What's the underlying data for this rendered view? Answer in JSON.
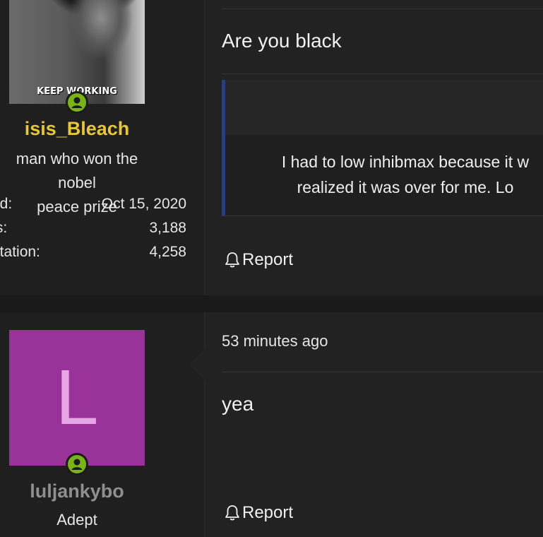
{
  "posts": [
    {
      "user": {
        "avatar_caption": "KEEP WORKING",
        "online_icon": "user-online-icon",
        "username": "isis_Bleach",
        "username_color": "#e8c53a",
        "title_lines": [
          "man who won the nobel",
          "peace prize"
        ],
        "stats": [
          {
            "label": "ed:",
            "value": "Oct 15, 2020"
          },
          {
            "label": "ts:",
            "value": "3,188"
          },
          {
            "label": "utation:",
            "value": "4,258"
          }
        ]
      },
      "text": "Are you black",
      "quote": {
        "lines": [
          "I had to low inhibmax because it w",
          "realized it was over for me. Lo"
        ],
        "border_color": "#2c3e7a"
      },
      "report_label": "Report"
    },
    {
      "user": {
        "avatar_letter": "L",
        "avatar_bg": "#993399",
        "avatar_letter_color": "#e5a6e5",
        "online_icon": "user-online-icon",
        "username": "luljankybo",
        "username_color": "#8f8f8f",
        "title": "Adept"
      },
      "timestamp": "53 minutes ago",
      "text": "yea",
      "report_label": "Report"
    }
  ],
  "colors": {
    "online_green": "#7bb21a",
    "background": "#1a1a1a"
  }
}
